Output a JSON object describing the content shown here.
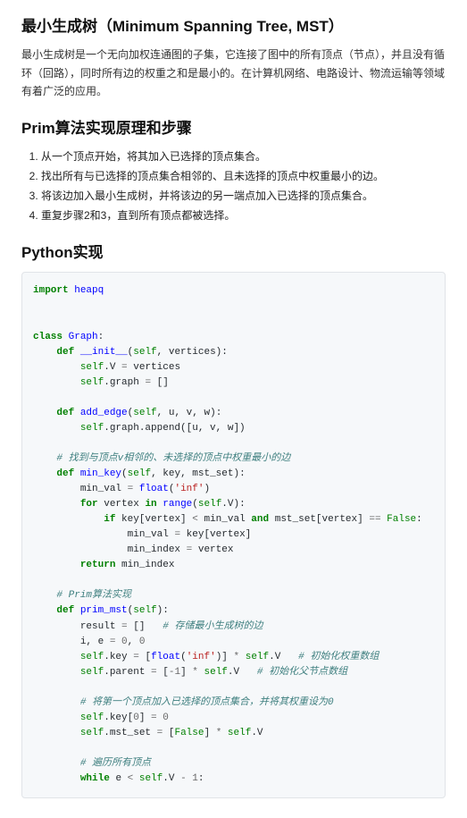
{
  "h1": "最小生成树（Minimum Spanning Tree, MST）",
  "intro": "最小生成树是一个无向加权连通图的子集，它连接了图中的所有顶点（节点），并且没有循环（回路），同时所有边的权重之和是最小的。在计算机网络、电路设计、物流运输等领域有着广泛的应用。",
  "h2_prim": "Prim算法实现原理和步骤",
  "steps": [
    "从一个顶点开始，将其加入已选择的顶点集合。",
    "找出所有与已选择的顶点集合相邻的、且未选择的顶点中权重最小的边。",
    "将该边加入最小生成树，并将该边的另一端点加入已选择的顶点集合。",
    "重复步骤2和3，直到所有顶点都被选择。"
  ],
  "h2_code": "Python实现",
  "code": {
    "l01a": "import",
    "l01b": "heapq",
    "l02a": "class",
    "l02b": "Graph",
    "l03a": "def",
    "l03b": "__init__",
    "l03c": "self",
    "l03d": "vertices",
    "l04a": "self",
    "l04b": ".V ",
    "l04c": "=",
    "l04d": "vertices",
    "l05a": "self",
    "l05b": ".graph ",
    "l05c": "=",
    "l05d": "[]",
    "l06a": "def",
    "l06b": "add_edge",
    "l06c": "self",
    "l06d": "u",
    "l06e": "v",
    "l06f": "w",
    "l07a": "self",
    "l07b": ".graph.append([u, v, w])",
    "l08": "# 找到与顶点v相邻的、未选择的顶点中权重最小的边",
    "l09a": "def",
    "l09b": "min_key",
    "l09c": "self",
    "l09d": "key",
    "l09e": "mst_set",
    "l10a": "min_val ",
    "l10b": "=",
    "l10c": "float",
    "l10d": "'inf'",
    "l11a": "for",
    "l11b": "vertex",
    "l11c": "in",
    "l11d": "range",
    "l11e": "self",
    "l11f": ".V):",
    "l12a": "if",
    "l12b": "key[vertex] ",
    "l12c": "<",
    "l12d": "min_val",
    "l12e": "and",
    "l12f": "mst_set[vertex] ",
    "l12g": "==",
    "l12h": "False",
    "l13a": "min_val ",
    "l13b": "=",
    "l13c": "key[vertex]",
    "l14a": "min_index ",
    "l14b": "=",
    "l14c": "vertex",
    "l15a": "return",
    "l15b": "min_index",
    "l16": "# Prim算法实现",
    "l17a": "def",
    "l17b": "prim_mst",
    "l17c": "self",
    "l18a": "result ",
    "l18b": "=",
    "l18c": "[]",
    "l18d": "# 存储最小生成树的边",
    "l19a": "i, e ",
    "l19b": "=",
    "l19c": "0",
    "l19d": "0",
    "l20a": "self",
    "l20b": ".key ",
    "l20c": "=",
    "l20d": "[",
    "l20e": "float",
    "l20f": "'inf'",
    "l20g": ")] ",
    "l20h": "*",
    "l20i": "self",
    "l20j": ".V",
    "l20k": "# 初始化权重数组",
    "l21a": "self",
    "l21b": ".parent ",
    "l21c": "=",
    "l21d": "[",
    "l21e": "-",
    "l21f": "1",
    "l21g": "] ",
    "l21h": "*",
    "l21i": "self",
    "l21j": ".V",
    "l21k": "# 初始化父节点数组",
    "l22": "# 将第一个顶点加入已选择的顶点集合，并将其权重设为0",
    "l23a": "self",
    "l23b": ".key[",
    "l23c": "0",
    "l23d": "] ",
    "l23e": "=",
    "l23f": "0",
    "l24a": "self",
    "l24b": ".mst_set ",
    "l24c": "=",
    "l24d": "[",
    "l24e": "False",
    "l24f": "] ",
    "l24g": "*",
    "l24h": "self",
    "l24i": ".V",
    "l25": "# 遍历所有顶点",
    "l26a": "while",
    "l26b": "e ",
    "l26c": "<",
    "l26d": "self",
    "l26e": ".V ",
    "l26f": "-",
    "l26g": "1"
  }
}
